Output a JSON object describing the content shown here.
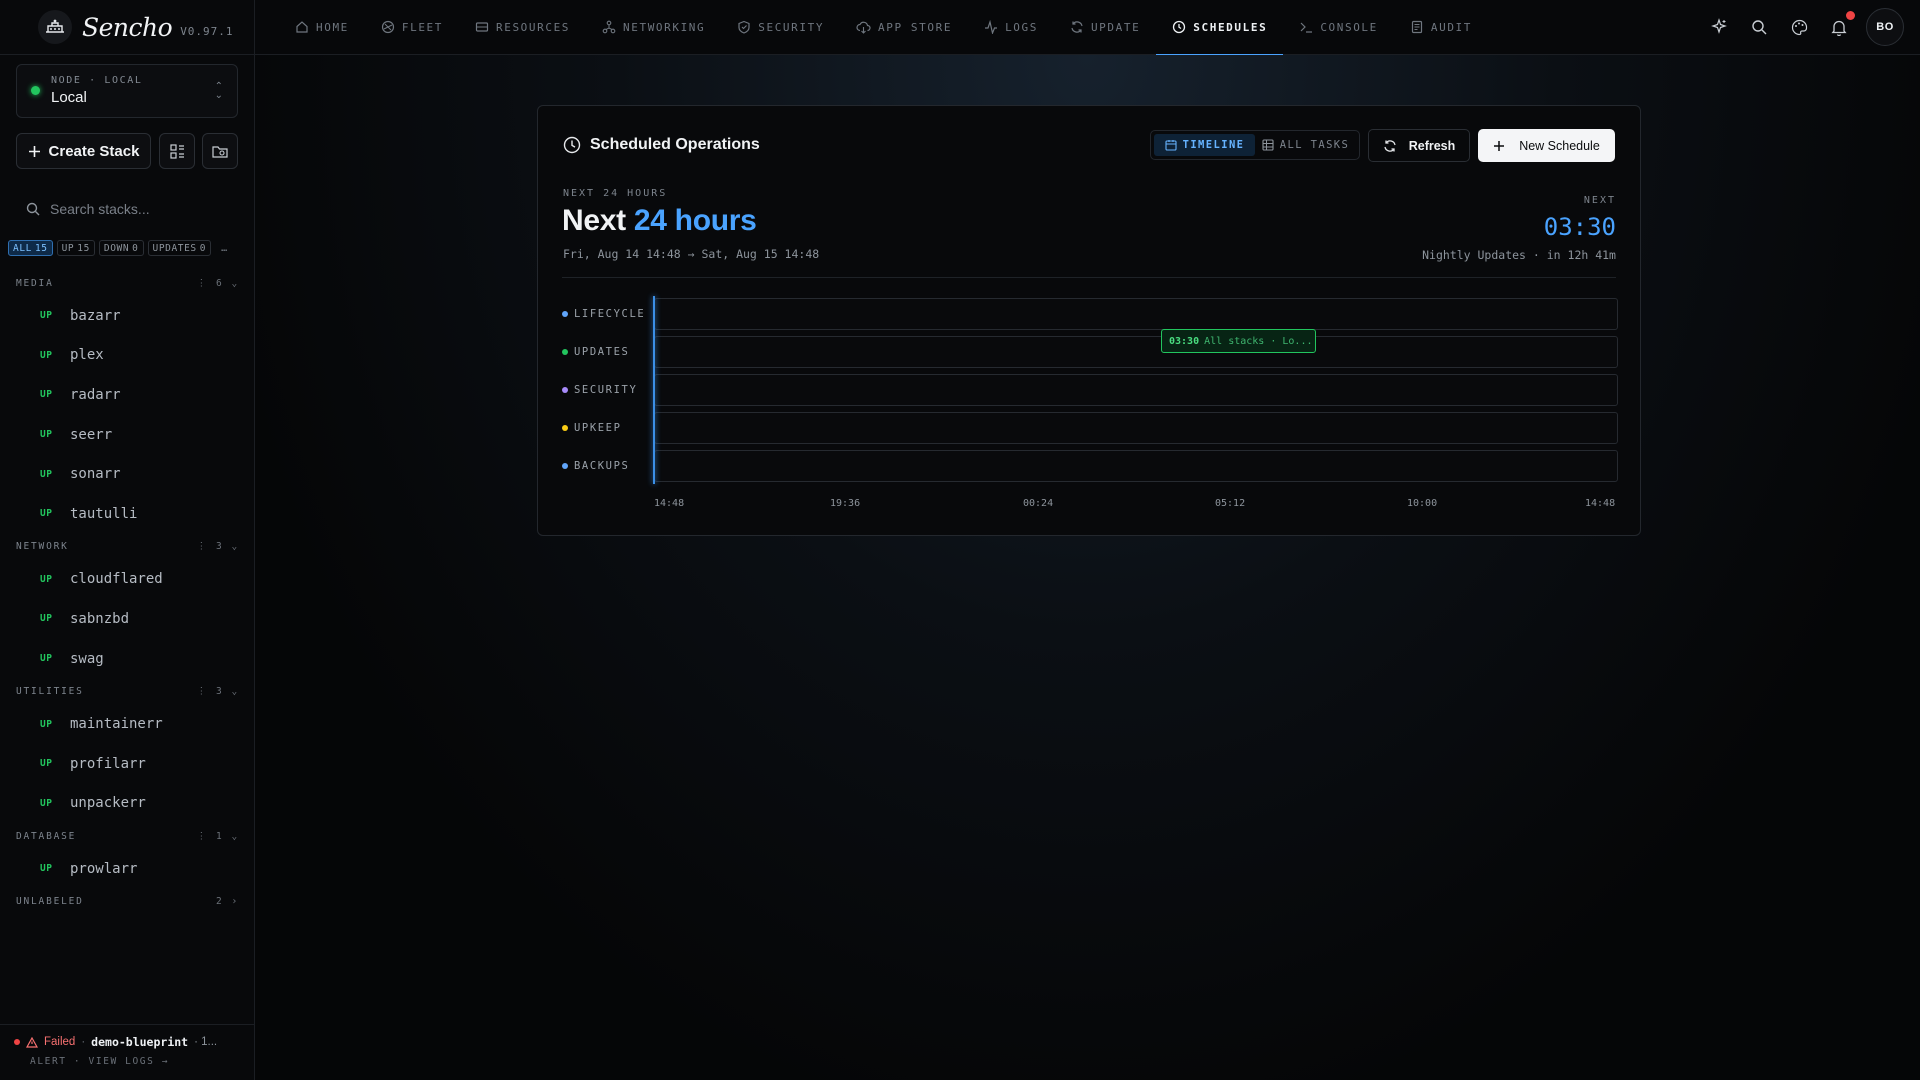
{
  "app": {
    "name": "Sencho",
    "version": "V0.97.1"
  },
  "node": {
    "label": "NODE · LOCAL",
    "name": "Local"
  },
  "sidebar": {
    "create_label": "Create Stack",
    "search_placeholder": "Search stacks...",
    "filters": [
      {
        "label": "ALL",
        "count": "15",
        "active": true
      },
      {
        "label": "UP",
        "count": "15",
        "active": false
      },
      {
        "label": "DOWN",
        "count": "0",
        "active": false
      },
      {
        "label": "UPDATES",
        "count": "0",
        "active": false
      }
    ],
    "more": "…",
    "groups": [
      {
        "name": "MEDIA",
        "count": "6",
        "expanded": true,
        "items": [
          {
            "status": "UP",
            "name": "bazarr"
          },
          {
            "status": "UP",
            "name": "plex"
          },
          {
            "status": "UP",
            "name": "radarr"
          },
          {
            "status": "UP",
            "name": "seerr"
          },
          {
            "status": "UP",
            "name": "sonarr"
          },
          {
            "status": "UP",
            "name": "tautulli"
          }
        ]
      },
      {
        "name": "NETWORK",
        "count": "3",
        "expanded": true,
        "items": [
          {
            "status": "UP",
            "name": "cloudflared"
          },
          {
            "status": "UP",
            "name": "sabnzbd"
          },
          {
            "status": "UP",
            "name": "swag"
          }
        ]
      },
      {
        "name": "UTILITIES",
        "count": "3",
        "expanded": true,
        "items": [
          {
            "status": "UP",
            "name": "maintainerr"
          },
          {
            "status": "UP",
            "name": "profilarr"
          },
          {
            "status": "UP",
            "name": "unpackerr"
          }
        ]
      },
      {
        "name": "DATABASE",
        "count": "1",
        "expanded": true,
        "items": [
          {
            "status": "UP",
            "name": "prowlarr"
          }
        ]
      },
      {
        "name": "UNLABELED",
        "count": "2",
        "expanded": false,
        "items": []
      }
    ],
    "footer": {
      "status": "Failed",
      "stack": "demo-blueprint",
      "extra": "· 1...",
      "sub": "ALERT · VIEW LOGS →"
    }
  },
  "nav": [
    {
      "label": "HOME",
      "icon": "home-icon",
      "active": false
    },
    {
      "label": "FLEET",
      "icon": "fleet-icon",
      "active": false
    },
    {
      "label": "RESOURCES",
      "icon": "resources-icon",
      "active": false
    },
    {
      "label": "NETWORKING",
      "icon": "networking-icon",
      "active": false
    },
    {
      "label": "SECURITY",
      "icon": "shield-icon",
      "active": false
    },
    {
      "label": "APP STORE",
      "icon": "cloud-icon",
      "active": false
    },
    {
      "label": "LOGS",
      "icon": "activity-icon",
      "active": false
    },
    {
      "label": "UPDATE",
      "icon": "refresh-icon",
      "active": false
    },
    {
      "label": "SCHEDULES",
      "icon": "clock-icon",
      "active": true
    },
    {
      "label": "CONSOLE",
      "icon": "terminal-icon",
      "active": false
    },
    {
      "label": "AUDIT",
      "icon": "audit-icon",
      "active": false
    }
  ],
  "user": {
    "initials": "BO"
  },
  "schedules": {
    "title": "Scheduled Operations",
    "view_timeline": "TIMELINE",
    "view_all": "ALL TASKS",
    "refresh": "Refresh",
    "new_schedule": "New Schedule",
    "kicker": "NEXT 24 HOURS",
    "headline_prefix": "Next",
    "headline_accent": "24 hours",
    "range": "Fri, Aug 14 14:48 → Sat, Aug 15 14:48",
    "next_label": "NEXT",
    "next_time": "03:30",
    "next_desc": "Nightly Updates · in 12h 41m",
    "lanes": [
      {
        "label": "LIFECYCLE",
        "color": "#60a5fa"
      },
      {
        "label": "UPDATES",
        "color": "#22c55e"
      },
      {
        "label": "SECURITY",
        "color": "#a78bfa"
      },
      {
        "label": "UPKEEP",
        "color": "#facc15"
      },
      {
        "label": "BACKUPS",
        "color": "#60a5fa"
      }
    ],
    "event": {
      "time": "03:30",
      "desc": "All stacks · Lo..."
    },
    "ticks": [
      "14:48",
      "19:36",
      "00:24",
      "05:12",
      "10:00",
      "14:48"
    ]
  },
  "colors": {
    "accent": "#4aa3ff",
    "success": "#22c55e",
    "danger": "#ef4444"
  }
}
